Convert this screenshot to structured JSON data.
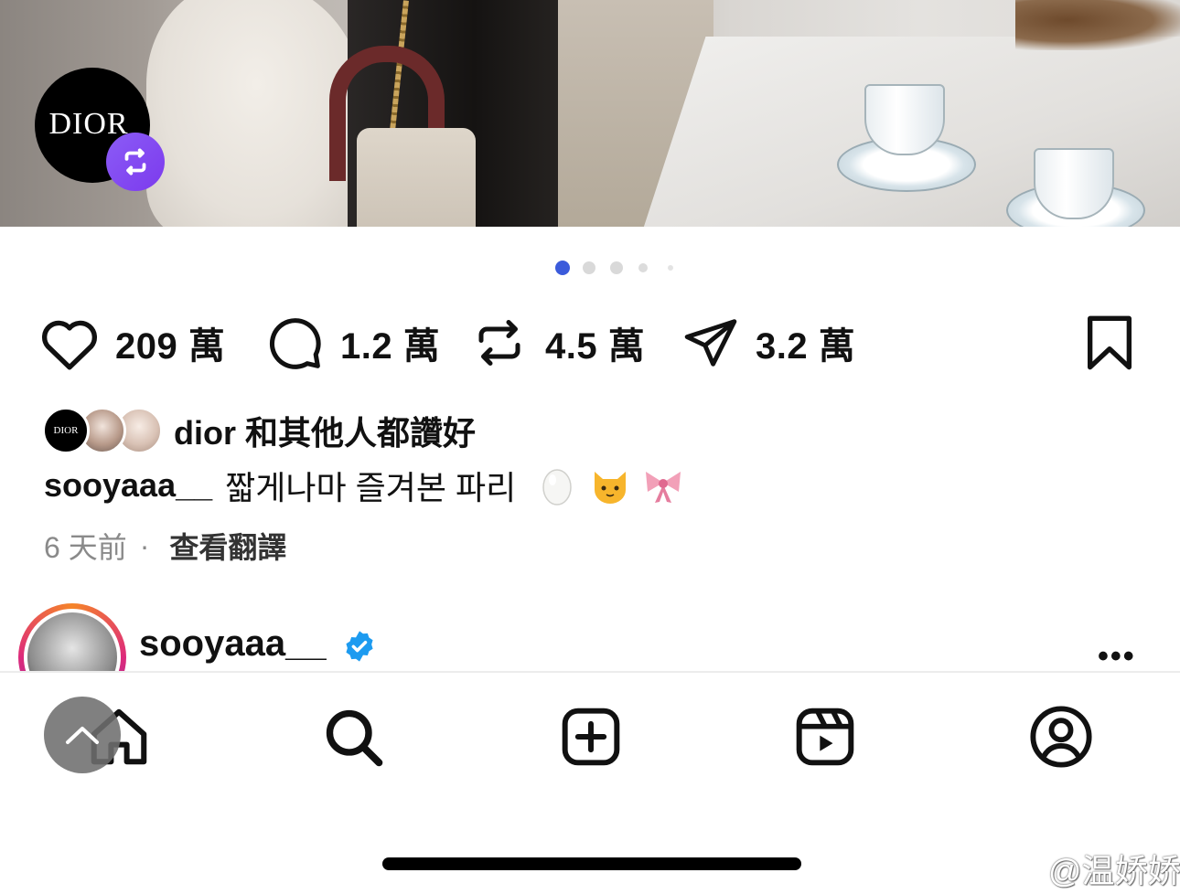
{
  "post": {
    "brand_avatar_text": "DIOR",
    "carousel": {
      "count": 5,
      "active_index": 0
    },
    "actions": {
      "likes": "209 萬",
      "comments": "1.2 萬",
      "reposts": "4.5 萬",
      "shares": "3.2 萬"
    },
    "liked_by": {
      "avatar_text": "DIOR",
      "text": "dior 和其他人都讚好"
    },
    "caption": {
      "username": "sooyaaa__",
      "text": "짧게나마 즐겨본 파리"
    },
    "time_ago": "6 天前",
    "separator": "·",
    "translate_label": "查看翻譯"
  },
  "next_post": {
    "username": "sooyaaa__",
    "more_label": "•••"
  },
  "colors": {
    "accent_dot": "#3b5bdb",
    "repost_badge": "#7c3aed",
    "verified": "#1d9bf0"
  },
  "tab_bar": {
    "items": [
      "home-icon",
      "search-icon",
      "create-icon",
      "reels-icon",
      "profile-icon"
    ]
  },
  "watermark": "@温娇娇i"
}
